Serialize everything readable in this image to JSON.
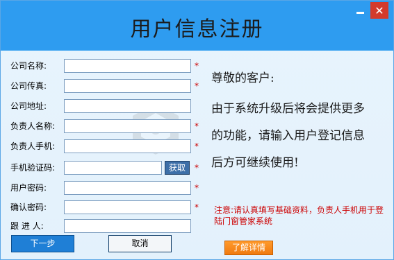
{
  "window": {
    "title": "用户信息注册",
    "minimize_label": "",
    "close_label": "✕"
  },
  "form": {
    "fields": [
      {
        "label": "公司名称:",
        "value": "",
        "required_mark": "*"
      },
      {
        "label": "公司传真:",
        "value": "",
        "required_mark": "*"
      },
      {
        "label": "公司地址:",
        "value": "",
        "required_mark": ""
      },
      {
        "label": "负责人名称:",
        "value": "",
        "required_mark": "*"
      },
      {
        "label": "负责人手机:",
        "value": "",
        "required_mark": "*"
      },
      {
        "label": "手机验证码:",
        "value": "",
        "required_mark": "*"
      },
      {
        "label": "用户密码:",
        "value": "",
        "required_mark": "*"
      },
      {
        "label": "确认密码:",
        "value": "",
        "required_mark": "*"
      },
      {
        "label": "跟 进 人:",
        "value": "",
        "required_mark": ""
      }
    ],
    "get_code_label": "获取",
    "next_label": "下一步",
    "cancel_label": "取消"
  },
  "message": {
    "greeting": "尊敬的客户:",
    "line1": "由于系统升级后将会提供更多",
    "line2": "的功能，请输入用户登记信息",
    "line3": "后方可继续使用!",
    "notice": "注意:请认真填写基础资料，负责人手机用于登陆门窗管家系统",
    "detail_label": "了解详情"
  },
  "colors": {
    "titlebar": "#2e9cf0",
    "close": "#d33a2c",
    "required": "#cc0000",
    "next_button": "#1f7fd6",
    "detail_button": "#f07a10"
  }
}
